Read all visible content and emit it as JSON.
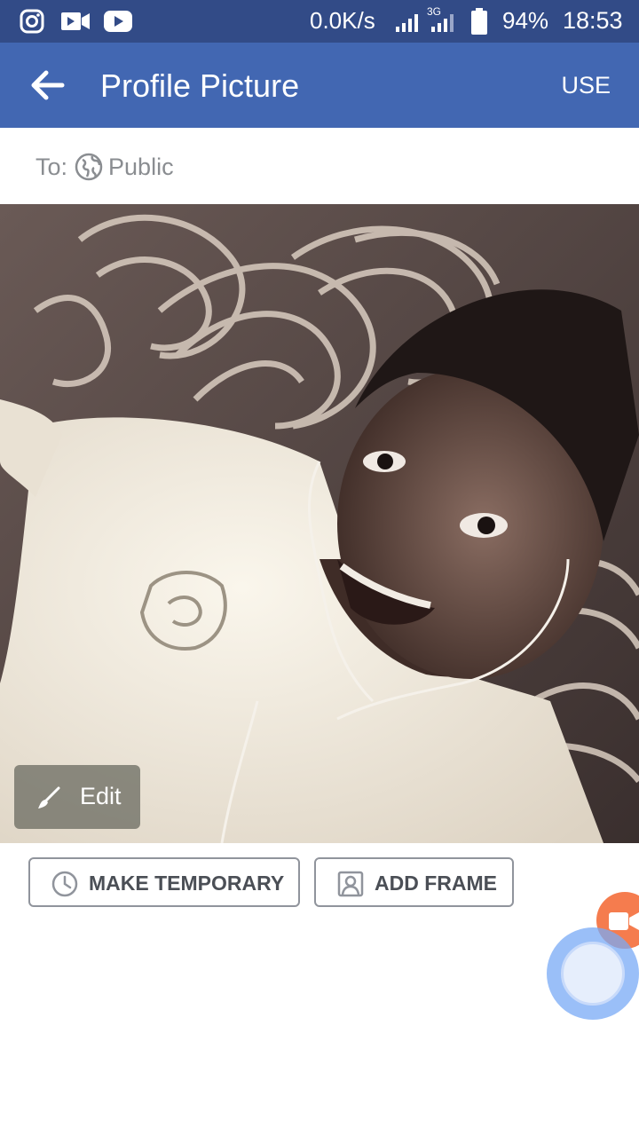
{
  "status_bar": {
    "network_speed": "0.0K/s",
    "network_type": "3G",
    "battery": "94%",
    "time": "18:53",
    "notification_icons": [
      "instagram-icon",
      "video-camera-icon",
      "youtube-icon"
    ]
  },
  "app_bar": {
    "title": "Profile Picture",
    "action_label": "USE",
    "background": "#4267b2"
  },
  "audience": {
    "prefix": "To:",
    "value": "Public",
    "icon": "globe-icon"
  },
  "photo": {
    "edit_label": "Edit"
  },
  "actions": {
    "make_temporary": "MAKE TEMPORARY",
    "add_frame": "ADD FRAME"
  },
  "colors": {
    "status_bar": "#324b87",
    "accent": "#4267b2",
    "button_text": "#4b4f56"
  }
}
